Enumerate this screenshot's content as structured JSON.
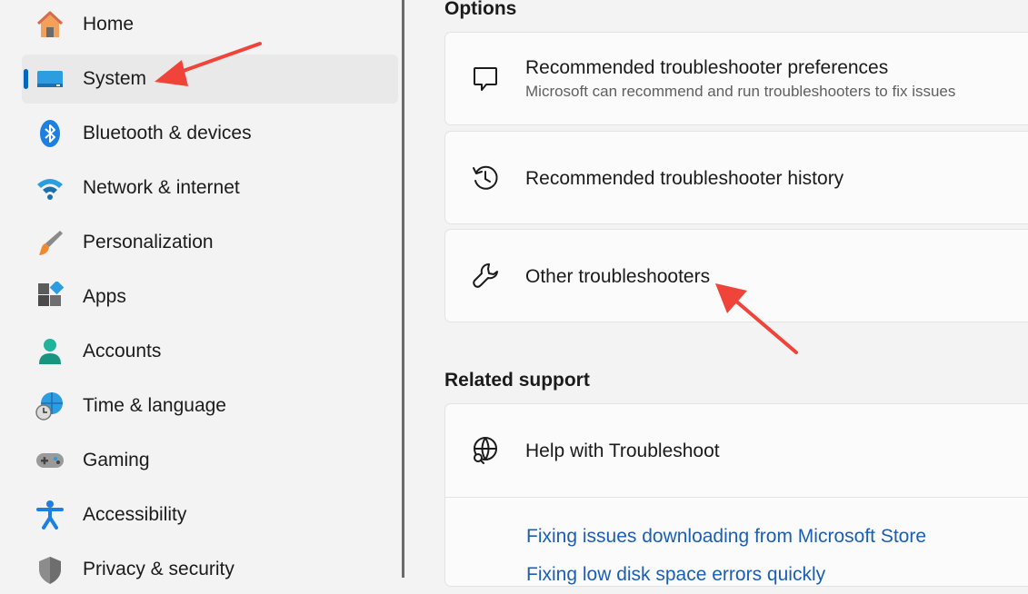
{
  "sidebar": {
    "items": [
      {
        "label": "Home",
        "icon": "home-icon"
      },
      {
        "label": "System",
        "icon": "system-icon",
        "selected": true
      },
      {
        "label": "Bluetooth & devices",
        "icon": "bluetooth-icon"
      },
      {
        "label": "Network & internet",
        "icon": "wifi-icon"
      },
      {
        "label": "Personalization",
        "icon": "brush-icon"
      },
      {
        "label": "Apps",
        "icon": "apps-icon"
      },
      {
        "label": "Accounts",
        "icon": "person-icon"
      },
      {
        "label": "Time & language",
        "icon": "globe-clock-icon"
      },
      {
        "label": "Gaming",
        "icon": "gamepad-icon"
      },
      {
        "label": "Accessibility",
        "icon": "accessibility-icon"
      },
      {
        "label": "Privacy & security",
        "icon": "shield-icon"
      }
    ]
  },
  "main": {
    "options_title": "Options",
    "options": [
      {
        "title": "Recommended troubleshooter preferences",
        "subtitle": "Microsoft can recommend and run troubleshooters to fix issues",
        "icon": "chat-icon"
      },
      {
        "title": "Recommended troubleshooter history",
        "icon": "history-icon"
      },
      {
        "title": "Other troubleshooters",
        "icon": "wrench-icon"
      }
    ],
    "related_title": "Related support",
    "related_card": {
      "title": "Help with Troubleshoot",
      "icon": "globe-search-icon"
    },
    "links": [
      "Fixing issues downloading from Microsoft Store",
      "Fixing low disk space errors quickly"
    ]
  },
  "colors": {
    "accent": "#0067c0",
    "link": "#1a5fb4",
    "annotation_arrow": "#f0443a"
  }
}
